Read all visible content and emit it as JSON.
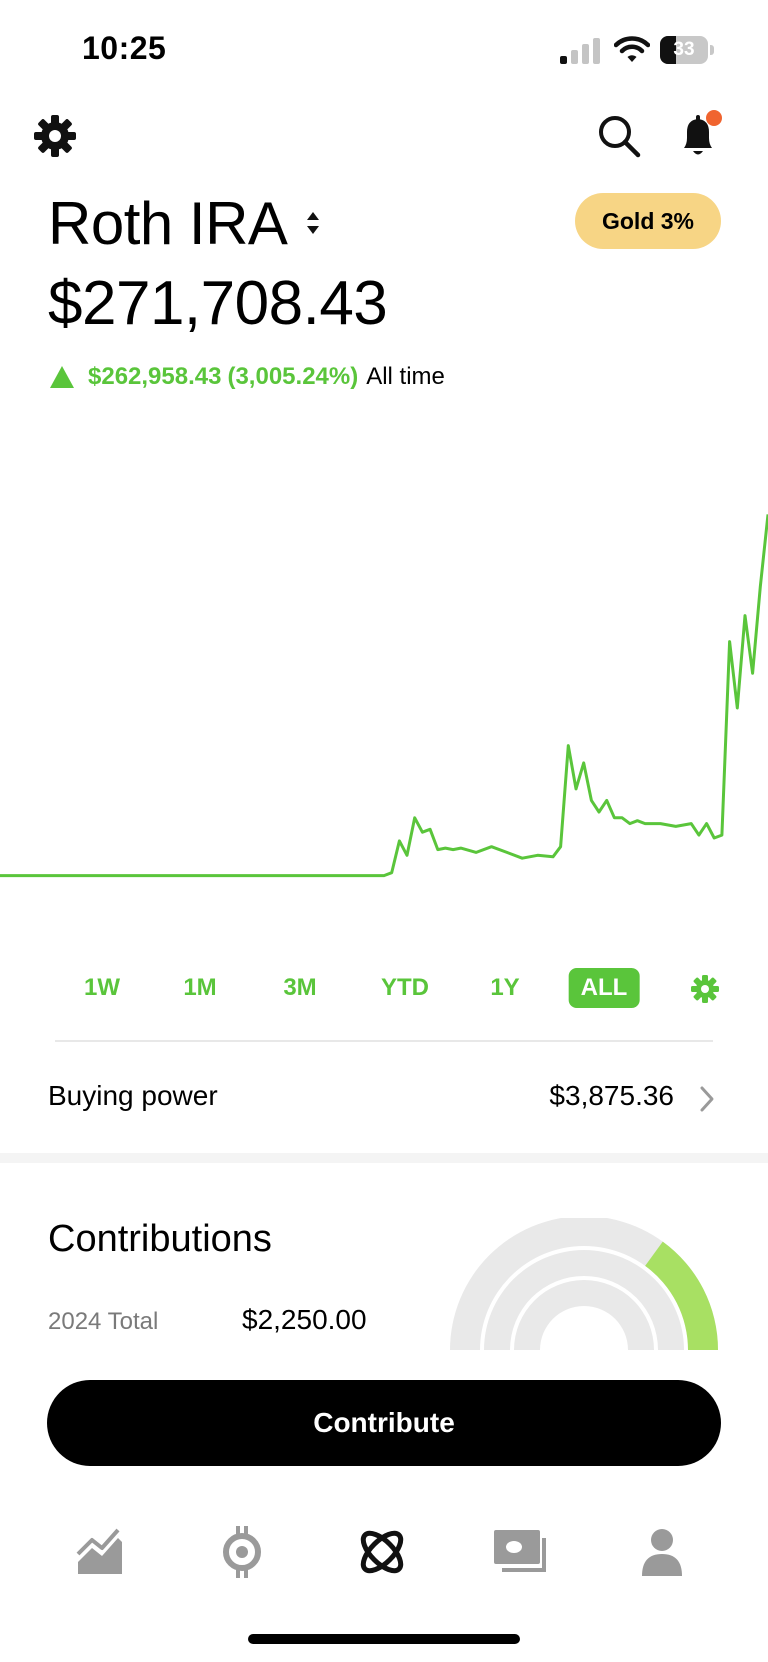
{
  "status_bar": {
    "time": "10:25",
    "battery": "33",
    "battery_level": 0.33
  },
  "header": {
    "icons": [
      "gear-icon",
      "search-icon",
      "bell-icon"
    ],
    "notification_dot_color": "#f0642f"
  },
  "account": {
    "name": "Roth IRA",
    "badge": "Gold 3%",
    "value": "$271,708.43",
    "gain_amount": "$262,958.43",
    "gain_percent": "(3,005.24%)",
    "gain_period": "All time"
  },
  "colors": {
    "accent_green": "#5ac53b",
    "gold_badge": "#f7d585",
    "gauge_fill": "#a8e063",
    "gauge_track": "#e9e9e9"
  },
  "chart_data": {
    "type": "line",
    "title": "",
    "xlabel": "",
    "ylabel": "",
    "grid": false,
    "x": [
      0,
      5,
      10,
      15,
      20,
      25,
      30,
      35,
      40,
      45,
      50,
      51,
      52,
      53,
      54,
      55,
      56,
      57,
      58,
      59,
      60,
      62,
      64,
      66,
      68,
      70,
      72,
      73,
      74,
      75,
      76,
      77,
      78,
      79,
      80,
      81,
      82,
      83,
      84,
      86,
      88,
      90,
      91,
      92,
      93,
      94,
      95,
      96,
      97,
      98,
      99,
      100
    ],
    "values": [
      0,
      0,
      0,
      0,
      0,
      0,
      0,
      0,
      0,
      0,
      0,
      1000,
      12000,
      7000,
      20000,
      15000,
      16000,
      9000,
      9500,
      9000,
      9500,
      8000,
      10000,
      8000,
      6000,
      7000,
      6500,
      10000,
      45000,
      30000,
      39000,
      26000,
      22000,
      26000,
      20000,
      20000,
      18000,
      19000,
      18000,
      18000,
      17000,
      18000,
      14000,
      18000,
      13000,
      14000,
      81000,
      58000,
      90000,
      70000,
      100000,
      125000
    ],
    "ylim": [
      -5000,
      130000
    ]
  },
  "range_tabs": [
    {
      "label": "1W",
      "active": false
    },
    {
      "label": "1M",
      "active": false
    },
    {
      "label": "3M",
      "active": false
    },
    {
      "label": "YTD",
      "active": false
    },
    {
      "label": "1Y",
      "active": false
    },
    {
      "label": "ALL",
      "active": true
    }
  ],
  "buying_power": {
    "label": "Buying power",
    "value": "$3,875.36"
  },
  "contributions": {
    "title": "Contributions",
    "total_label": "2024 Total",
    "total_value": "$2,250.00",
    "progress": 0.3
  },
  "contribute_button": "Contribute",
  "bottom_nav": {
    "items": [
      {
        "icon": "chart-icon",
        "active": false
      },
      {
        "icon": "crypto-icon",
        "active": false
      },
      {
        "icon": "retirement-icon",
        "active": true
      },
      {
        "icon": "cash-icon",
        "active": false
      },
      {
        "icon": "account-icon",
        "active": false
      }
    ]
  }
}
